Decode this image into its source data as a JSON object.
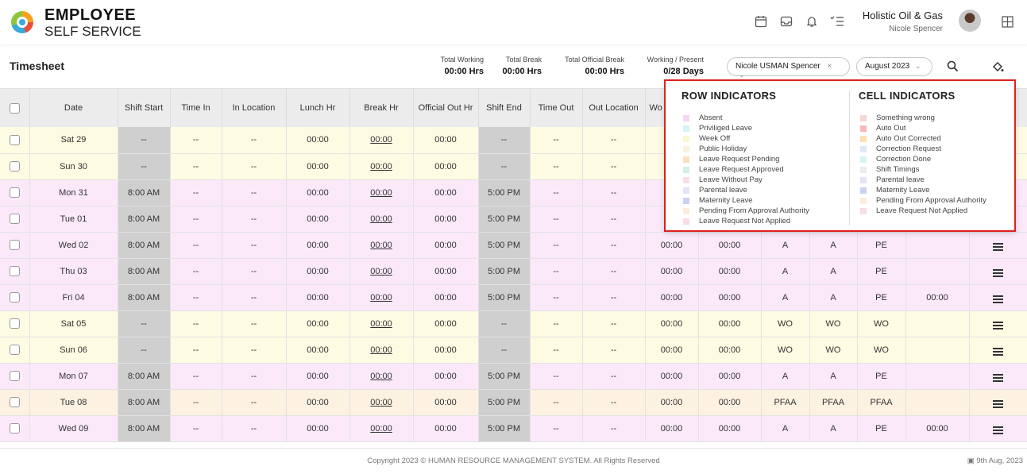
{
  "header": {
    "brand_line1": "EMPLOYEE",
    "brand_line2": "SELF SERVICE",
    "company": "Holistic Oil & Gas",
    "user": "Nicole Spencer",
    "icons": [
      "calendar-icon",
      "inbox-icon",
      "bell-icon",
      "checklist-icon",
      "grid-icon"
    ]
  },
  "toolbar": {
    "title": "Timesheet",
    "stats": [
      {
        "label": "Total Working",
        "value": "00:00 Hrs"
      },
      {
        "label": "Total Break",
        "value": "00:00 Hrs"
      },
      {
        "label": "Total Official Break",
        "value": "00:00 Hrs"
      },
      {
        "label": "Working / Present",
        "value": "0/28 Days"
      }
    ],
    "employee_select": "Nicole USMAN Spencer",
    "month_select": "August 2023"
  },
  "table": {
    "headers": [
      "Date",
      "Shift Start",
      "Time In",
      "In Location",
      "Lunch Hr",
      "Break Hr",
      "Official Out Hr",
      "Shift End",
      "Time Out",
      "Out Location",
      "Wo"
    ],
    "rows": [
      {
        "date": "Sat 29",
        "type": "yellow",
        "shift_start": "--",
        "time_in": "--",
        "in_loc": "--",
        "lunch": "00:00",
        "brk": "00:00",
        "official": "00:00",
        "shift_end": "--",
        "time_out": "--",
        "out_loc": "--",
        "c11": "",
        "c12": "",
        "c13": "",
        "c14": "",
        "c15": "",
        "c16": ""
      },
      {
        "date": "Sun 30",
        "type": "yellow",
        "shift_start": "--",
        "time_in": "--",
        "in_loc": "--",
        "lunch": "00:00",
        "brk": "00:00",
        "official": "00:00",
        "shift_end": "--",
        "time_out": "--",
        "out_loc": "--",
        "c11": "",
        "c12": "",
        "c13": "",
        "c14": "",
        "c15": "",
        "c16": ""
      },
      {
        "date": "Mon 31",
        "type": "pink",
        "shift_start": "8:00 AM",
        "time_in": "--",
        "in_loc": "--",
        "lunch": "00:00",
        "brk": "00:00",
        "official": "00:00",
        "shift_end": "5:00 PM",
        "time_out": "--",
        "out_loc": "--",
        "c11": "",
        "c12": "",
        "c13": "",
        "c14": "",
        "c15": "",
        "c16": ""
      },
      {
        "date": "Tue 01",
        "type": "pink",
        "shift_start": "8:00 AM",
        "time_in": "--",
        "in_loc": "--",
        "lunch": "00:00",
        "brk": "00:00",
        "official": "00:00",
        "shift_end": "5:00 PM",
        "time_out": "--",
        "out_loc": "--",
        "c11": "",
        "c12": "",
        "c13": "",
        "c14": "",
        "c15": "",
        "c16": ""
      },
      {
        "date": "Wed 02",
        "type": "pink",
        "shift_start": "8:00 AM",
        "time_in": "--",
        "in_loc": "--",
        "lunch": "00:00",
        "brk": "00:00",
        "official": "00:00",
        "shift_end": "5:00 PM",
        "time_out": "--",
        "out_loc": "--",
        "c11": "00:00",
        "c12": "00:00",
        "c13": "A",
        "c14": "A",
        "c15": "PE",
        "c16": ""
      },
      {
        "date": "Thu 03",
        "type": "pink",
        "shift_start": "8:00 AM",
        "time_in": "--",
        "in_loc": "--",
        "lunch": "00:00",
        "brk": "00:00",
        "official": "00:00",
        "shift_end": "5:00 PM",
        "time_out": "--",
        "out_loc": "--",
        "c11": "00:00",
        "c12": "00:00",
        "c13": "A",
        "c14": "A",
        "c15": "PE",
        "c16": ""
      },
      {
        "date": "Fri 04",
        "type": "pink",
        "shift_start": "8:00 AM",
        "time_in": "--",
        "in_loc": "--",
        "lunch": "00:00",
        "brk": "00:00",
        "official": "00:00",
        "shift_end": "5:00 PM",
        "time_out": "--",
        "out_loc": "--",
        "c11": "00:00",
        "c12": "00:00",
        "c13": "A",
        "c14": "A",
        "c15": "PE",
        "c16": "00:00"
      },
      {
        "date": "Sat 05",
        "type": "yellow",
        "shift_start": "--",
        "time_in": "--",
        "in_loc": "--",
        "lunch": "00:00",
        "brk": "00:00",
        "official": "00:00",
        "shift_end": "--",
        "time_out": "--",
        "out_loc": "--",
        "c11": "00:00",
        "c12": "00:00",
        "c13": "WO",
        "c14": "WO",
        "c15": "WO",
        "c16": ""
      },
      {
        "date": "Sun 06",
        "type": "yellow",
        "shift_start": "--",
        "time_in": "--",
        "in_loc": "--",
        "lunch": "00:00",
        "brk": "00:00",
        "official": "00:00",
        "shift_end": "--",
        "time_out": "--",
        "out_loc": "--",
        "c11": "00:00",
        "c12": "00:00",
        "c13": "WO",
        "c14": "WO",
        "c15": "WO",
        "c16": ""
      },
      {
        "date": "Mon 07",
        "type": "pink",
        "shift_start": "8:00 AM",
        "time_in": "--",
        "in_loc": "--",
        "lunch": "00:00",
        "brk": "00:00",
        "official": "00:00",
        "shift_end": "5:00 PM",
        "time_out": "--",
        "out_loc": "--",
        "c11": "00:00",
        "c12": "00:00",
        "c13": "A",
        "c14": "A",
        "c15": "PE",
        "c16": ""
      },
      {
        "date": "Tue 08",
        "type": "peach",
        "shift_start": "8:00 AM",
        "time_in": "--",
        "in_loc": "--",
        "lunch": "00:00",
        "brk": "00:00",
        "official": "00:00",
        "shift_end": "5:00 PM",
        "time_out": "--",
        "out_loc": "--",
        "c11": "00:00",
        "c12": "00:00",
        "c13": "PFAA",
        "c14": "PFAA",
        "c15": "PFAA",
        "c16": ""
      },
      {
        "date": "Wed 09",
        "type": "pink",
        "shift_start": "8:00 AM",
        "time_in": "--",
        "in_loc": "--",
        "lunch": "00:00",
        "brk": "00:00",
        "official": "00:00",
        "shift_end": "5:00 PM",
        "time_out": "--",
        "out_loc": "--",
        "c11": "00:00",
        "c12": "00:00",
        "c13": "A",
        "c14": "A",
        "c15": "PE",
        "c16": "00:00"
      }
    ]
  },
  "indicators": {
    "row_title": "ROW INDICATORS",
    "cell_title": "CELL INDICATORS",
    "row": [
      {
        "label": "Absent",
        "color": "#f6d6f3"
      },
      {
        "label": "Priviliged Leave",
        "color": "#d6f3f7"
      },
      {
        "label": "Week Off",
        "color": "#fbf7d2"
      },
      {
        "label": "Public Holiday",
        "color": "#fbf2dd"
      },
      {
        "label": "Leave Request Pending",
        "color": "#fbe0bd"
      },
      {
        "label": "Leave Request Approved",
        "color": "#d3f0e6"
      },
      {
        "label": "Leave Without Pay",
        "color": "#f6e0e6"
      },
      {
        "label": "Parental leave",
        "color": "#e4e4f6"
      },
      {
        "label": "Maternity Leave",
        "color": "#cbd1f2"
      },
      {
        "label": "Pending From Approval Authority",
        "color": "#fbeedd"
      },
      {
        "label": "Leave Request Not Applied",
        "color": "#f9dbe9"
      }
    ],
    "cell": [
      {
        "label": "Something wrong",
        "color": "#f8d6d6"
      },
      {
        "label": "Auto Out",
        "color": "#f6b9b9"
      },
      {
        "label": "Auto Out Corrected",
        "color": "#fbe0b4"
      },
      {
        "label": "Correction Request",
        "color": "#dde8f7"
      },
      {
        "label": "Correction Done",
        "color": "#d3f5f5"
      },
      {
        "label": "Shift Timings",
        "color": "#ececec"
      },
      {
        "label": "Parental leave",
        "color": "#e4e4f6"
      },
      {
        "label": "Maternity Leave",
        "color": "#cbd1f2"
      },
      {
        "label": "Pending From Approval Authority",
        "color": "#fbeedd"
      },
      {
        "label": "Leave Request Not Applied",
        "color": "#f9dbe9"
      }
    ]
  },
  "footer": {
    "copyright": "Copyright 2023 © HUMAN RESOURCE MANAGEMENT SYSTEM. All Rights Reserved",
    "date": "9th Aug, 2023"
  }
}
